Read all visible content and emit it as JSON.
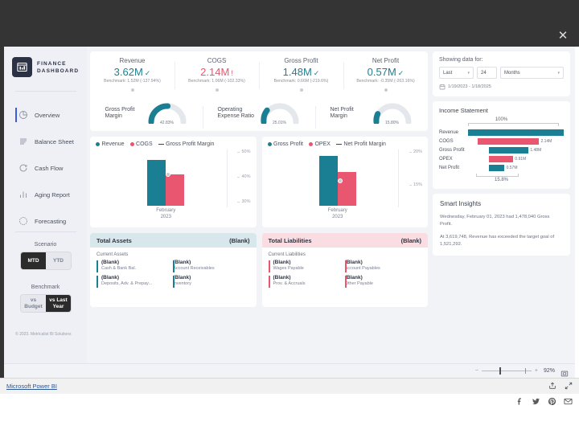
{
  "window": {
    "close_label": "✕"
  },
  "brand": {
    "line1": "FINANCE",
    "line2": "DASHBOARD"
  },
  "nav": {
    "items": [
      {
        "label": "Overview",
        "icon": "pie-chart-icon",
        "active": true
      },
      {
        "label": "Balance Sheet",
        "icon": "list-lines-icon",
        "active": false
      },
      {
        "label": "Cash Flow",
        "icon": "refresh-cycle-icon",
        "active": false
      },
      {
        "label": "Aging Report",
        "icon": "bar-chart-icon",
        "active": false
      },
      {
        "label": "Forecasting",
        "icon": "clock-icon",
        "active": false
      }
    ],
    "scenario": {
      "title": "Scenario",
      "options": [
        "MTD",
        "YTD"
      ],
      "selected": "MTD"
    },
    "benchmark": {
      "title": "Benchmark",
      "options": [
        "vs Budget",
        "vs Last Year"
      ],
      "selected": "vs Last Year",
      "opt1_line1": "vs",
      "opt1_line2": "Budget",
      "opt2_line1": "vs Last",
      "opt2_line2": "Year"
    },
    "copyright": "© 2023. Metricalist BI Solutions"
  },
  "kpis": [
    {
      "label": "Revenue",
      "value": "3.62M",
      "mark": "✓",
      "state": "good",
      "benchmark": "Benchmark: 1.52M (-137.94%)"
    },
    {
      "label": "COGS",
      "value": "2.14M",
      "mark": "!",
      "state": "bad",
      "benchmark": "Benchmark: 1.06M (-102.33%)"
    },
    {
      "label": "Gross Profit",
      "value": "1.48M",
      "mark": "✓",
      "state": "good",
      "benchmark": "Benchmark: 0.66M (-219.6%)"
    },
    {
      "label": "Net Profit",
      "value": "0.57M",
      "mark": "✓",
      "state": "good",
      "benchmark": "Benchmark: -0.35M (-263.16%)"
    }
  ],
  "gauges": [
    {
      "label_line1": "Gross Profit",
      "label_line2": "Margin",
      "value": "42.83%",
      "pct": 42.83
    },
    {
      "label_line1": "Operating",
      "label_line2": "Expense Ratio",
      "value": "25.01%",
      "pct": 25.01
    },
    {
      "label_line1": "Net Profit",
      "label_line2": "Margin",
      "value": "15.80%",
      "pct": 15.8
    }
  ],
  "chart_data": [
    {
      "type": "bar",
      "title": "",
      "legend": [
        "Revenue",
        "COGS",
        "Gross Profit Margin"
      ],
      "legend_position": "top-left",
      "categories": [
        "February\n2023"
      ],
      "category_line1": "February",
      "category_line2": "2023",
      "series": [
        {
          "name": "Revenue",
          "values": [
            3.62
          ],
          "color": "#1b7f93"
        },
        {
          "name": "COGS",
          "values": [
            2.14
          ],
          "color": "#e8566f"
        }
      ],
      "line_series": {
        "name": "Gross Profit Margin",
        "values": [
          42.83
        ],
        "color": "#c5cbd4"
      },
      "ylabel": "",
      "ytick_labels": [
        "50%",
        "40%",
        "30%"
      ],
      "ylim": [
        30,
        50
      ],
      "grid": false
    },
    {
      "type": "bar",
      "title": "",
      "legend": [
        "Gross Profit",
        "OPEX",
        "Net Profit Margin"
      ],
      "legend_position": "top-left",
      "categories": [
        "February\n2023"
      ],
      "category_line1": "February",
      "category_line2": "2023",
      "series": [
        {
          "name": "Gross Profit",
          "values": [
            1.48
          ],
          "color": "#1b7f93"
        },
        {
          "name": "OPEX",
          "values": [
            0.91
          ],
          "color": "#e8566f"
        }
      ],
      "line_series": {
        "name": "Net Profit Margin",
        "values": [
          15.8
        ],
        "color": "#c5cbd4"
      },
      "ylabel": "",
      "ytick_labels": [
        "20%",
        "15%"
      ],
      "ylim": [
        13,
        21
      ],
      "grid": false
    },
    {
      "type": "bar",
      "title": "Income Statement",
      "orientation": "horizontal",
      "top_annotation": "100%",
      "bottom_annotation": "15.8%",
      "categories": [
        "Revenue",
        "COGS",
        "Gross Profit",
        "OPEX",
        "Net Profit"
      ],
      "values": [
        3.62,
        2.14,
        1.48,
        0.91,
        0.57
      ],
      "value_labels": [
        "",
        "2.14M",
        "1.48M",
        "0.91M",
        "0.57M"
      ],
      "colors": [
        "#1b7f93",
        "#e8566f",
        "#1b7f93",
        "#e8566f",
        "#1b7f93"
      ],
      "ylabel": "",
      "xlabel": ""
    }
  ],
  "balance": {
    "assets": {
      "title": "Total Assets",
      "total": "(Blank)",
      "subtitle": "Current Assets",
      "items": [
        {
          "value": "(Blank)",
          "name": "Cash & Bank Bal."
        },
        {
          "value": "(Blank)",
          "name": "Account Receivables"
        },
        {
          "value": "(Blank)",
          "name": "Deposits, Adv. & Prepay..."
        },
        {
          "value": "(Blank)",
          "name": "Inventory"
        }
      ]
    },
    "liabilities": {
      "title": "Total Liabilities",
      "total": "(Blank)",
      "subtitle": "Current Liabilities",
      "items": [
        {
          "value": "(Blank)",
          "name": "Wages Payable"
        },
        {
          "value": "(Blank)",
          "name": "Account Payables"
        },
        {
          "value": "(Blank)",
          "name": "Prov. & Accruals"
        },
        {
          "value": "(Blank)",
          "name": "Other Payable"
        }
      ]
    }
  },
  "filter": {
    "title": "Showing data for:",
    "range_selected": "Last",
    "count_value": "24",
    "unit_selected": "Months",
    "date_range": "1/19/2023 - 1/18/2025"
  },
  "income_statement": {
    "title": "Income Statement",
    "top_label": "100%",
    "bottom_label": "15.8%",
    "rows": [
      {
        "name": "Revenue",
        "amount": ""
      },
      {
        "name": "COGS",
        "amount": "2.14M"
      },
      {
        "name": "Gross Profit",
        "amount": "1.48M"
      },
      {
        "name": "OPEX",
        "amount": "0.91M"
      },
      {
        "name": "Net Profit",
        "amount": "0.57M"
      }
    ]
  },
  "insights": {
    "title": "Smart Insights",
    "p1": "Wednesday, February 01, 2023 had 1,478,040 Gross Profit.",
    "p2": "At 3,619,748, Revenue has exceeded the target goal of 1,521,292."
  },
  "bottom_bar": {
    "zoom": "92%",
    "fit_icon": "fit-to-page-icon"
  },
  "footer": {
    "link": "Microsoft Power BI",
    "share_icon": "share-icon",
    "fullscreen_icon": "fullscreen-icon",
    "social": [
      "facebook-icon",
      "twitter-icon",
      "pinterest-icon",
      "email-icon"
    ]
  },
  "colors": {
    "teal": "#1b7f93",
    "pink": "#e8566f",
    "dark": "#2b3245",
    "accent": "#3b5bdb"
  }
}
